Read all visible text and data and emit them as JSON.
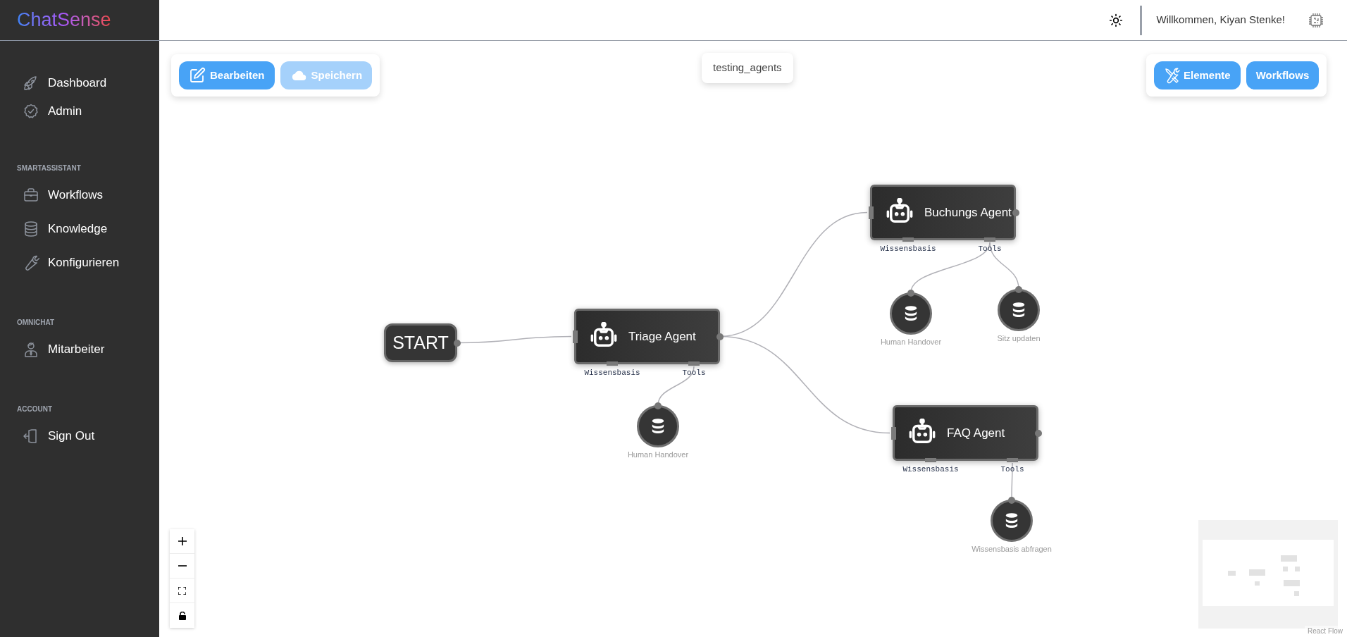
{
  "sidebar": {
    "logo": "ChatSense",
    "sections": [
      {
        "items": [
          {
            "label": "Dashboard"
          },
          {
            "label": "Admin"
          }
        ]
      },
      {
        "title": "SMARTASSISTANT",
        "items": [
          {
            "label": "Workflows"
          },
          {
            "label": "Knowledge"
          },
          {
            "label": "Konfigurieren"
          }
        ]
      },
      {
        "title": "OMNICHAT",
        "items": [
          {
            "label": "Mitarbeiter"
          }
        ]
      },
      {
        "title": "ACCOUNT",
        "items": [
          {
            "label": "Sign Out"
          }
        ]
      }
    ]
  },
  "header": {
    "welcome": "Willkommen, Kiyan Stenke!"
  },
  "toolbar": {
    "left_buttons": [
      {
        "label": "Bearbeiten",
        "disabled": false
      },
      {
        "label": "Speichern",
        "disabled": true
      }
    ],
    "workflow_name": "testing_agents",
    "right_buttons": [
      {
        "label": "Elemente"
      },
      {
        "label": "Workflows"
      }
    ]
  },
  "canvas": {
    "start": {
      "label": "START"
    },
    "agents": [
      {
        "name": "Triage Agent",
        "handles": [
          "Wissensbasis",
          "Tools"
        ],
        "tools": [
          {
            "label": "Human Handover"
          }
        ]
      },
      {
        "name": "Buchungs Agent",
        "handles": [
          "Wissensbasis",
          "Tools"
        ],
        "tools": [
          {
            "label": "Human Handover"
          },
          {
            "label": "Sitz updaten"
          }
        ]
      },
      {
        "name": "FAQ Agent",
        "handles": [
          "Wissensbasis",
          "Tools"
        ],
        "tools": [
          {
            "label": "Wissensbasis abfragen"
          }
        ]
      }
    ],
    "attribution": "React Flow"
  }
}
